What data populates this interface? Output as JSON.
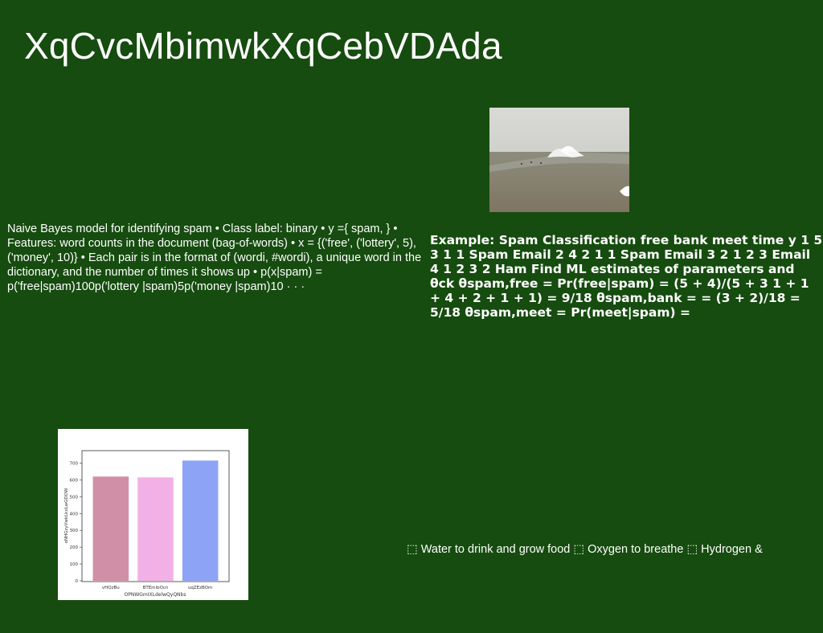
{
  "slide": {
    "title": "XqCvcMbimwkXqCebVDAda",
    "left_text": "Naive Bayes model for identifying spam • Class label: binary • y ={ spam, } • Features: word counts in the document (bag-of-words) • x = {('free', ('lottery', 5), ('money', 10)} • Each pair is in the format of (wordi, #wordi), a unique word in the dictionary, and the number of times it shows up • p(x|spam) = p('free|spam)100p('lottery |spam)5p('money |spam)10 · · ·",
    "right_text": "Example: Spam Classification free bank meet time y 1 5 3 1 1 Spam Email 2 4 2 1 1 Spam Email 3 2 1 2 3 Email 4 1 2 3 2 Ham Find ML estimates of parameters and θck θspam,free = Pr(free|spam) = (5 + 4)/(5 + 3 1 + 1 + 4 + 2 + 1 + 1) = 9/18 θspam,bank = = (3 + 2)/18 = 5/18 θspam,meet = Pr(meet|spam) =",
    "bottom_text": "⬚ Water to drink and grow food ⬚ Oxygen to breathe ⬚ Hydrogen &"
  },
  "photo": {
    "icon": "ocean-wave-photo"
  },
  "chart_data": {
    "type": "bar",
    "categories": [
      "vHQzBu",
      "BTEmibOcn",
      "uqZEzBOm"
    ],
    "values": [
      620,
      615,
      715
    ],
    "colors": [
      "#d18fa7",
      "#f2b1e6",
      "#8da3f5"
    ],
    "xlabel": "OPNWGmIXLdelwQyQNbs",
    "ylabel": "oNHGzyVwkLkxLwGDOW",
    "yticks": [
      0,
      100,
      200,
      300,
      400,
      500,
      600,
      700
    ],
    "ylim": [
      0,
      750
    ],
    "grid": false
  }
}
